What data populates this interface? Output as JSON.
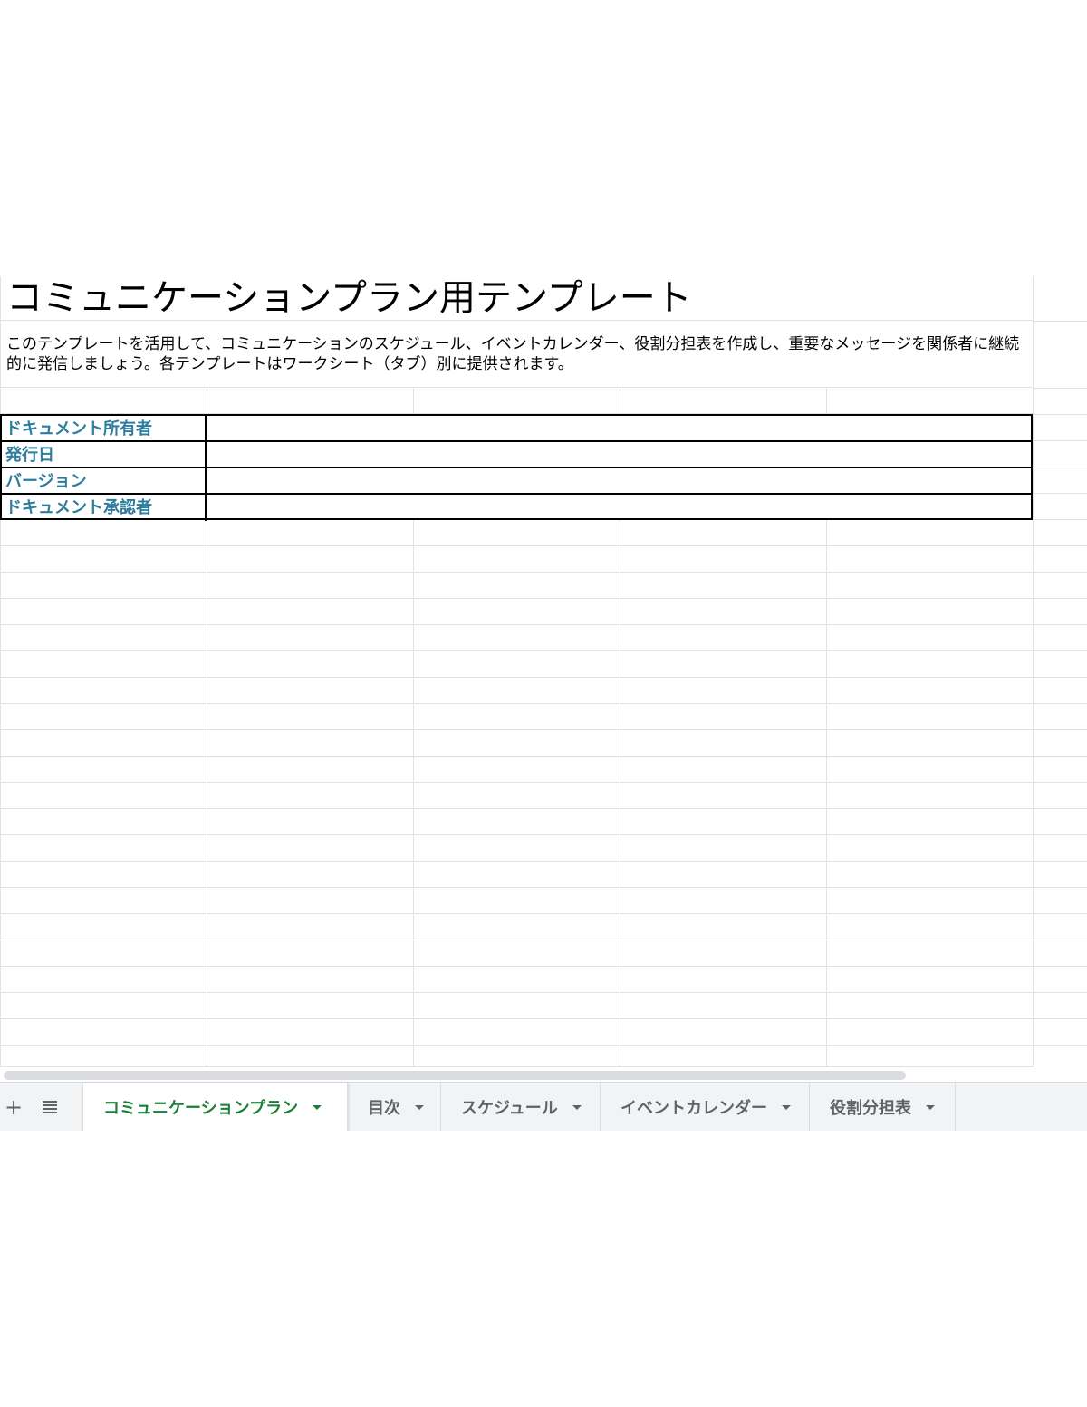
{
  "sheet": {
    "title": "コミュニケーションプラン用テンプレート",
    "description": "このテンプレートを活用して、コミュニケーションのスケジュール、イベントカレンダー、役割分担表を作成し、重要なメッセージを関係者に継続的に発信しましょう。各テンプレートはワークシート（タブ）別に提供されます。",
    "meta_fields": [
      {
        "label": "ドキュメント所有者",
        "value": ""
      },
      {
        "label": "発行日",
        "value": ""
      },
      {
        "label": "バージョン",
        "value": ""
      },
      {
        "label": "ドキュメント承認者",
        "value": ""
      }
    ]
  },
  "tab_bar": {
    "add_icon": "plus-icon",
    "list_icon": "list-icon",
    "add_symbol": "+",
    "tabs": [
      {
        "label": "コミュニケーションプラン",
        "active": true
      },
      {
        "label": "目次",
        "active": false
      },
      {
        "label": "スケジュール",
        "active": false
      },
      {
        "label": "イベントカレンダー",
        "active": false
      },
      {
        "label": "役割分担表",
        "active": false
      }
    ]
  },
  "colors": {
    "label_blue": "#2e7d9e",
    "active_tab_green": "#188038",
    "grid_line": "#e2e2e2"
  }
}
